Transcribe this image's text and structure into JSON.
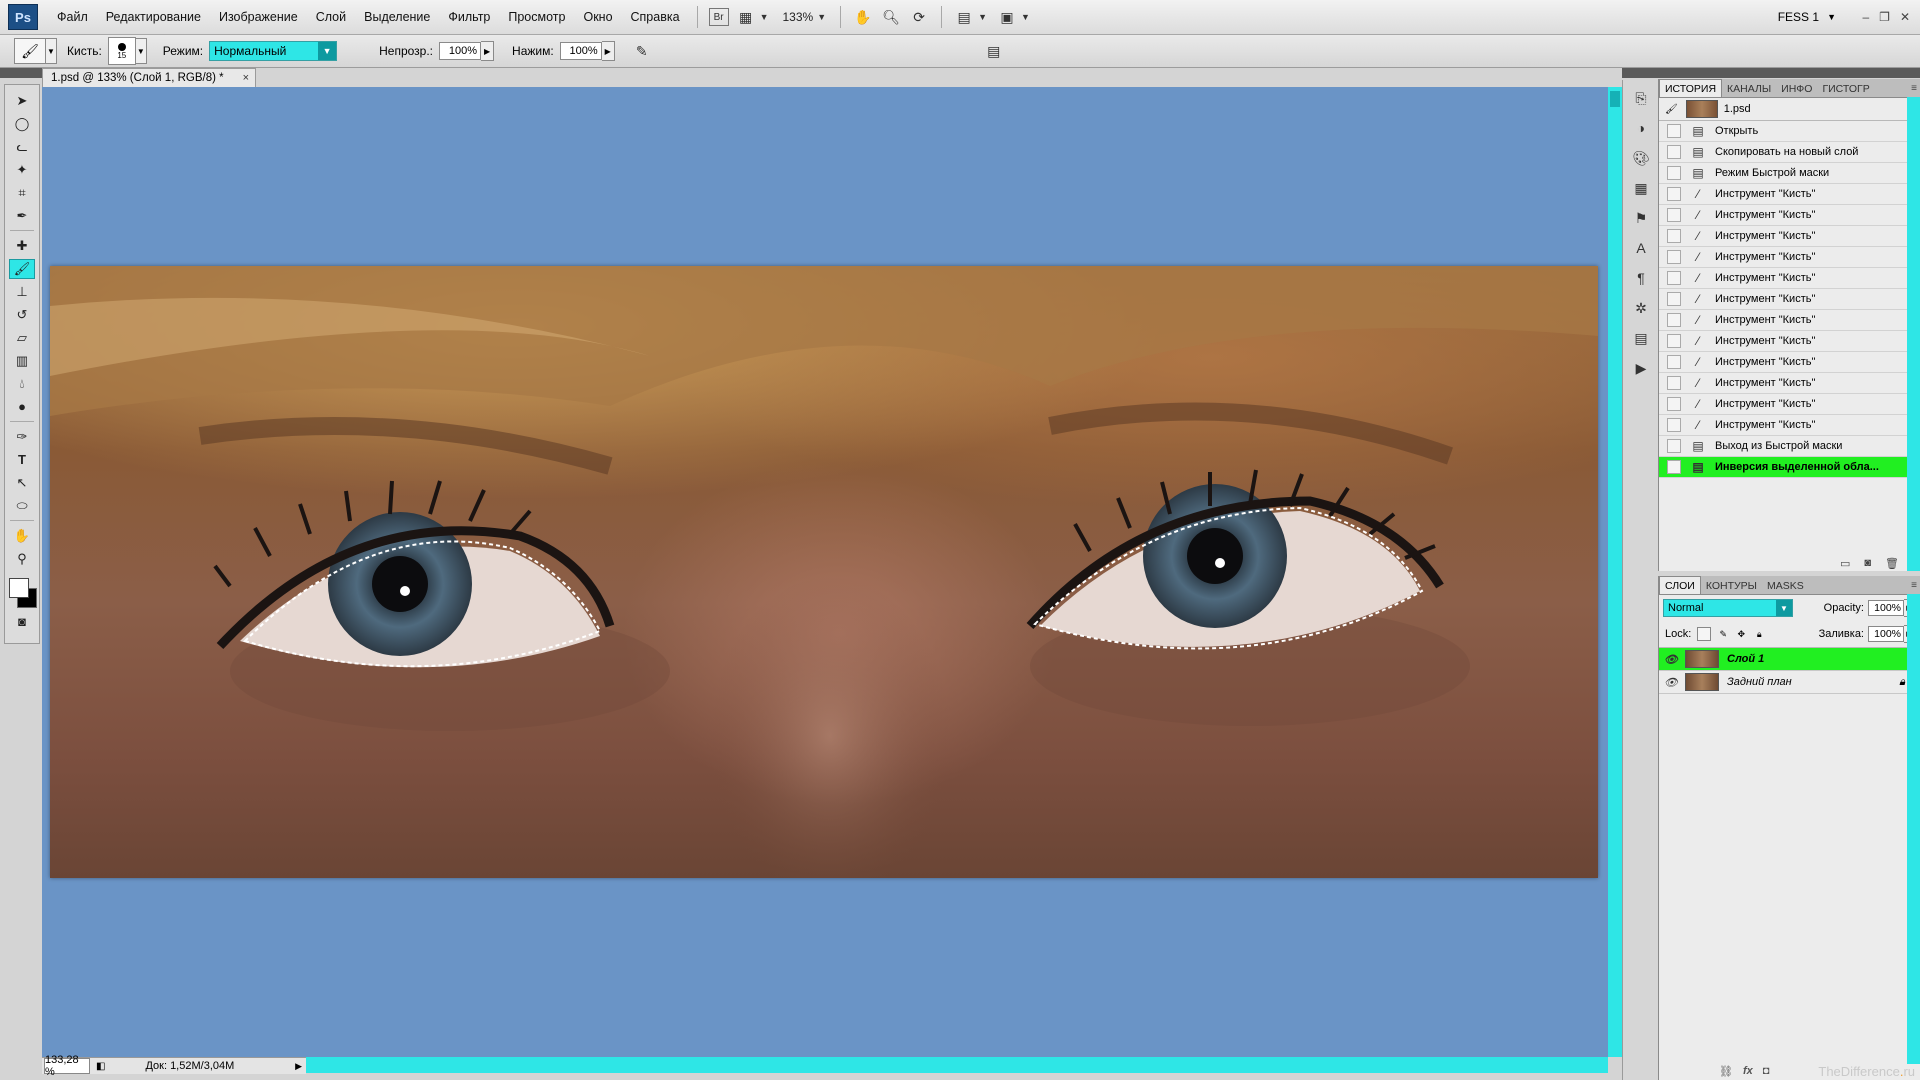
{
  "app": {
    "logo": "Ps",
    "workspace": "FESS 1"
  },
  "menu": [
    "Файл",
    "Редактирование",
    "Изображение",
    "Слой",
    "Выделение",
    "Фильтр",
    "Просмотр",
    "Окно",
    "Справка"
  ],
  "menubar": {
    "zoom": "133%",
    "bridge_label": "Br"
  },
  "options": {
    "brush_label": "Кисть:",
    "brush_size": "15",
    "mode_label": "Режим:",
    "mode_value": "Нормальный",
    "opacity_label": "Непрозр.:",
    "opacity_value": "100%",
    "flow_label": "Нажим:",
    "flow_value": "100%"
  },
  "document": {
    "tab_title": "1.psd @ 133% (Слой 1, RGB/8) *",
    "status_zoom": "133,28 %",
    "status_doc": "Док: 1,52M/3,04M"
  },
  "history_panel": {
    "tabs": [
      "ИСТОРИЯ",
      "КАНАЛЫ",
      "ИНФО",
      "ГИСТОГР"
    ],
    "snapshot": "1.psd",
    "items": [
      "Открыть",
      "Скопировать на новый слой",
      "Режим Быстрой маски",
      "Инструмент \"Кисть\"",
      "Инструмент \"Кисть\"",
      "Инструмент \"Кисть\"",
      "Инструмент \"Кисть\"",
      "Инструмент \"Кисть\"",
      "Инструмент \"Кисть\"",
      "Инструмент \"Кисть\"",
      "Инструмент \"Кисть\"",
      "Инструмент \"Кисть\"",
      "Инструмент \"Кисть\"",
      "Инструмент \"Кисть\"",
      "Инструмент \"Кисть\"",
      "Выход из Быстрой маски",
      "Инверсия выделенной обла..."
    ],
    "active_index": 16
  },
  "layers_panel": {
    "tabs": [
      "СЛОИ",
      "КОНТУРЫ",
      "MASKS"
    ],
    "blend_mode": "Normal",
    "opacity_label": "Opacity:",
    "opacity_value": "100%",
    "lock_label": "Lock:",
    "fill_label": "Заливка:",
    "fill_value": "100%",
    "layers": [
      "Слой 1",
      "Задний план"
    ],
    "active_index": 0
  },
  "watermark": {
    "prefix": "TheDifference",
    "suffix": "ru"
  },
  "colors": {
    "accent_cyan": "#2ee6e6",
    "active_green": "#21ef21",
    "canvas_bg": "#6a94c6"
  }
}
